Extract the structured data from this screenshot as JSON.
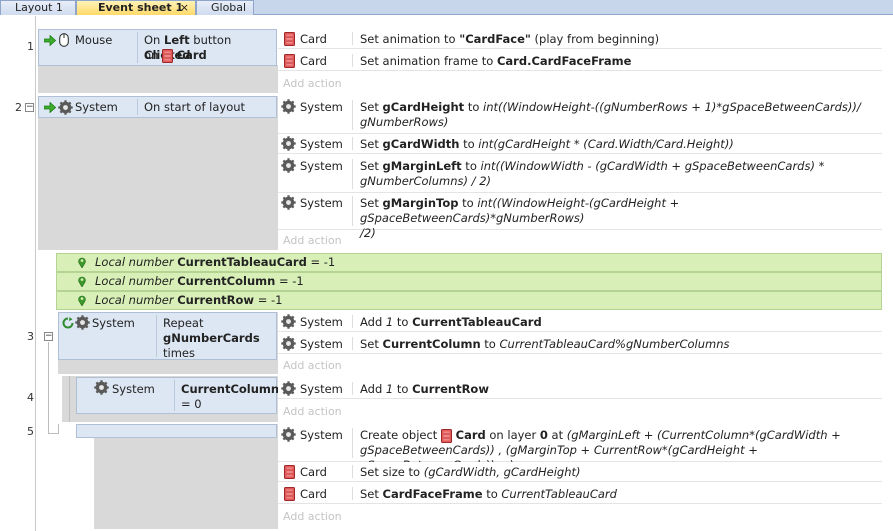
{
  "tabs": [
    {
      "label": "Layout 1"
    },
    {
      "label": "Event sheet 1",
      "close": "×"
    },
    {
      "label": "Global"
    }
  ],
  "events": {
    "e1": {
      "num": "1",
      "cond_object": "Mouse",
      "cond_text": [
        "On ",
        "Left",
        " button ",
        "Clicked",
        "on",
        "Card"
      ],
      "actions": [
        {
          "object": "Card",
          "text": [
            "Set animation to ",
            "\"CardFace\"",
            " (play from beginning)"
          ]
        },
        {
          "object": "Card",
          "text": [
            "Set animation frame to ",
            "Card.CardFaceFrame"
          ]
        }
      ]
    },
    "e2": {
      "num": "2",
      "toggle": "−",
      "cond_object": "System",
      "cond_text": "On start of layout",
      "actions": [
        {
          "object": "System",
          "text": [
            "Set ",
            "gCardHeight",
            " to ",
            "int((WindowHeight-((gNumberRows + 1)*gSpaceBetweenCards))/",
            "gNumberRows)"
          ]
        },
        {
          "object": "System",
          "text": [
            "Set ",
            "gCardWidth",
            " to ",
            "int(gCardHeight * (Card.Width/Card.Height))"
          ]
        },
        {
          "object": "System",
          "text": [
            "Set ",
            "gMarginLeft",
            " to ",
            "int((WindowWidth - (gCardWidth + gSpaceBetweenCards) *",
            "gNumberColumns) / 2)"
          ]
        },
        {
          "object": "System",
          "text": [
            "Set ",
            "gMarginTop",
            " to ",
            "int((WindowHeight-(gCardHeight + gSpaceBetweenCards)*gNumberRows)",
            "/2)"
          ]
        }
      ]
    },
    "locals": [
      {
        "kind": "Local number",
        "name": "CurrentTableauCard",
        "value": "= -1"
      },
      {
        "kind": "Local number",
        "name": "CurrentColumn",
        "value": "= -1"
      },
      {
        "kind": "Local number",
        "name": "CurrentRow",
        "value": "= -1"
      }
    ],
    "e3": {
      "num": "3",
      "toggle": "−",
      "cond_object": "System",
      "cond_text": [
        "Repeat",
        "gNumberCards",
        "times"
      ],
      "actions": [
        {
          "object": "System",
          "text": [
            "Add ",
            "1",
            " to ",
            "CurrentTableauCard"
          ]
        },
        {
          "object": "System",
          "text": [
            "Set ",
            "CurrentColumn",
            " to ",
            "CurrentTableauCard%gNumberColumns"
          ]
        }
      ]
    },
    "e4": {
      "num": "4",
      "cond_object": "System",
      "cond_text": [
        "CurrentColumn",
        "= 0"
      ],
      "actions": [
        {
          "object": "System",
          "text": [
            "Add ",
            "1",
            " to ",
            "CurrentRow"
          ]
        }
      ]
    },
    "e5": {
      "num": "5",
      "actions": [
        {
          "object": "System",
          "text": [
            "Create object ",
            "Card",
            " on layer ",
            "0",
            " at ",
            "(gMarginLeft + (CurrentColumn*(gCardWidth +",
            "gSpaceBetweenCards)) , (gMarginTop + CurrentRow*(gCardHeight + gSpaceBetweenCards))",
            ")"
          ]
        },
        {
          "object": "Card",
          "text": [
            "Set size to ",
            "(gCardWidth, gCardHeight)"
          ]
        },
        {
          "object": "Card",
          "text": [
            "Set ",
            "CardFaceFrame",
            " to ",
            "CurrentTableauCard"
          ]
        }
      ]
    },
    "add_action": "Add action"
  }
}
